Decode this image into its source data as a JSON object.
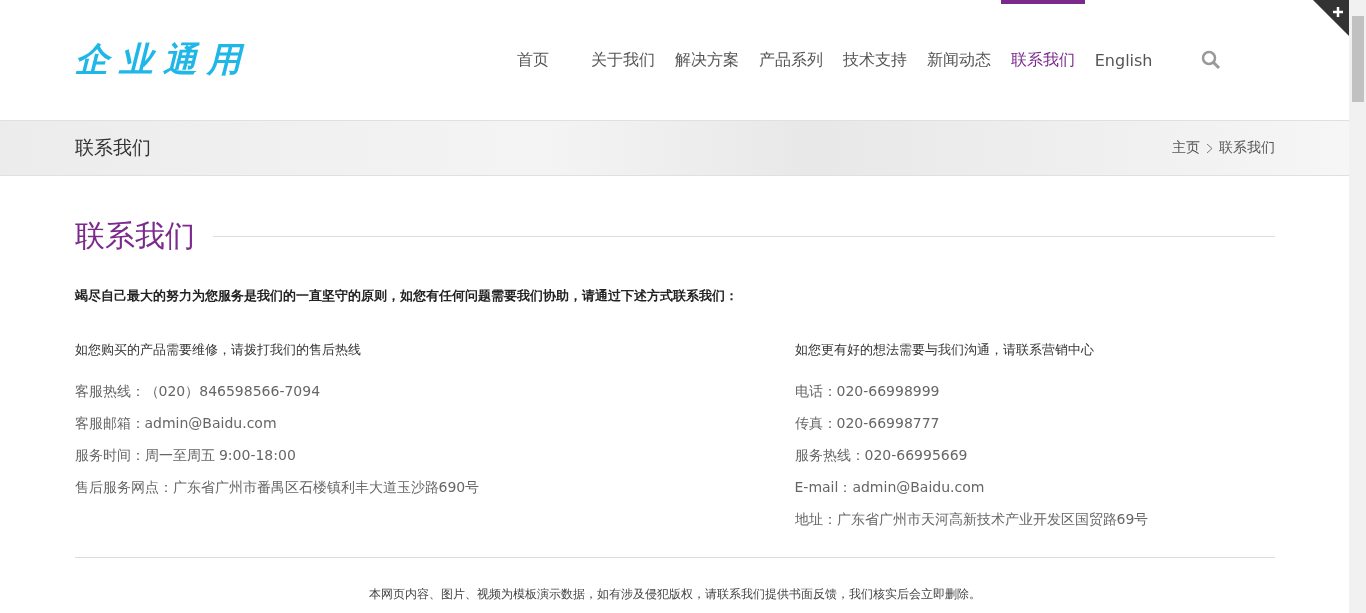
{
  "logo": "企业通用",
  "nav": [
    {
      "label": "首页",
      "selected": false
    },
    {
      "label": "关于我们",
      "selected": false
    },
    {
      "label": "解决方案",
      "selected": false
    },
    {
      "label": "产品系列",
      "selected": false
    },
    {
      "label": "技术支持",
      "selected": false
    },
    {
      "label": "新闻动态",
      "selected": false
    },
    {
      "label": "联系我们",
      "selected": true
    },
    {
      "label": "English",
      "selected": false
    }
  ],
  "banner": {
    "title": "联系我们",
    "breadcrumb": [
      "主页",
      "联系我们"
    ]
  },
  "section_title": "联系我们",
  "intro": "竭尽自己最大的努力为您服务是我们的一直坚守的原则，如您有任何问题需要我们协助，请通过下述方式联系我们：",
  "columns": [
    {
      "heading": "如您购买的产品需要维修，请拨打我们的售后热线",
      "lines": [
        "客服热线：（020）846598566-7094",
        "客服邮箱：admin@Baidu.com",
        "服务时间：周一至周五 9:00-18:00",
        "售后服务网点：广东省广州市番禺区石楼镇利丰大道玉沙路690号"
      ]
    },
    {
      "heading": "如您更有好的想法需要与我们沟通，请联系营销中心",
      "lines": [
        "电话：020-66998999",
        "传真：020-66998777",
        "服务热线：020-66995669",
        "E-mail：admin@Baidu.com",
        "地址：广东省广州市天河高新技术产业开发区国贸路69号"
      ]
    }
  ],
  "footer": "本网页内容、图片、视频为模板演示数据，如有涉及侵犯版权，请联系我们提供书面反馈，我们核实后会立即删除。"
}
